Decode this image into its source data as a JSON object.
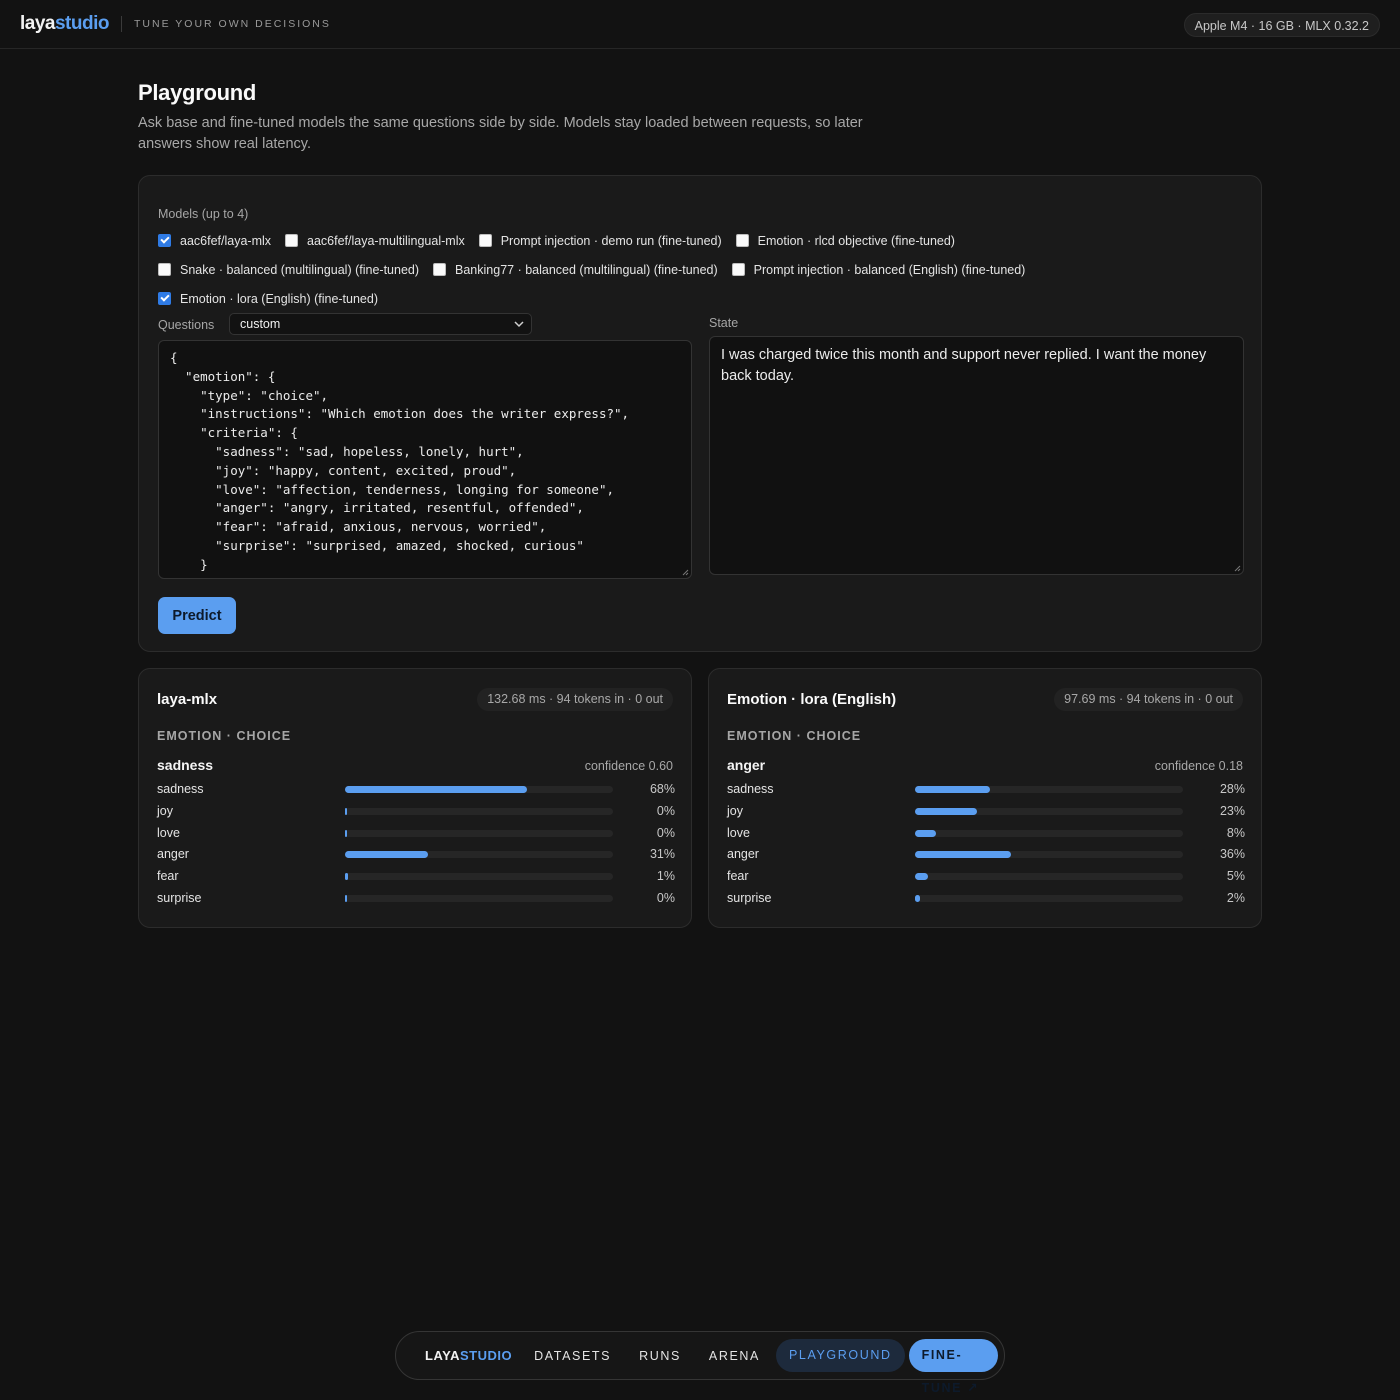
{
  "topbar": {
    "logo_part1": "laya",
    "logo_part2": "studio",
    "tagline": "TUNE YOUR OWN DECISIONS",
    "hardware": "Apple M4 · 16 GB · MLX 0.32.2"
  },
  "header": {
    "title": "Playground",
    "description": "Ask base and fine-tuned models the same questions side by side. Models stay loaded between requests, so later answers show real latency."
  },
  "models": {
    "label": "Models (up to 4)",
    "rows": [
      [
        {
          "label": "aac6fef/laya-mlx",
          "checked": true
        },
        {
          "label": "aac6fef/laya-multilingual-mlx",
          "checked": false
        },
        {
          "label": "Prompt injection · demo run (fine-tuned)",
          "checked": false
        },
        {
          "label": "Emotion · rlcd objective (fine-tuned)",
          "checked": false
        }
      ],
      [
        {
          "label": "Snake · balanced (multilingual) (fine-tuned)",
          "checked": false
        },
        {
          "label": "Banking77 · balanced (multilingual) (fine-tuned)",
          "checked": false
        },
        {
          "label": "Prompt injection · balanced (English) (fine-tuned)",
          "checked": false
        }
      ],
      [
        {
          "label": "Emotion · lora (English) (fine-tuned)",
          "checked": true
        }
      ]
    ]
  },
  "questions": {
    "label": "Questions",
    "selected": "custom",
    "code": "{\n  \"emotion\": {\n    \"type\": \"choice\",\n    \"instructions\": \"Which emotion does the writer express?\",\n    \"criteria\": {\n      \"sadness\": \"sad, hopeless, lonely, hurt\",\n      \"joy\": \"happy, content, excited, proud\",\n      \"love\": \"affection, tenderness, longing for someone\",\n      \"anger\": \"angry, irritated, resentful, offended\",\n      \"fear\": \"afraid, anxious, nervous, worried\",\n      \"surprise\": \"surprised, amazed, shocked, curious\"\n    }\n  }\n}"
  },
  "state": {
    "label": "State",
    "value": "I was charged twice this month and support never replied. I want the money back today."
  },
  "predict_label": "Predict",
  "results": [
    {
      "title": "laya-mlx",
      "meta": "132.68 ms · 94 tokens in · 0 out",
      "subtitle": "EMOTION · CHOICE",
      "prediction": "sadness",
      "confidence": "confidence 0.60",
      "rows": [
        {
          "name": "sadness",
          "pct": 68,
          "label": "68%"
        },
        {
          "name": "joy",
          "pct": 0,
          "label": "0%"
        },
        {
          "name": "love",
          "pct": 0,
          "label": "0%"
        },
        {
          "name": "anger",
          "pct": 31,
          "label": "31%"
        },
        {
          "name": "fear",
          "pct": 1,
          "label": "1%"
        },
        {
          "name": "surprise",
          "pct": 0,
          "label": "0%"
        }
      ]
    },
    {
      "title": "Emotion · lora (English)",
      "meta": "97.69 ms · 94 tokens in · 0 out",
      "subtitle": "EMOTION · CHOICE",
      "prediction": "anger",
      "confidence": "confidence 0.18",
      "rows": [
        {
          "name": "sadness",
          "pct": 28,
          "label": "28%"
        },
        {
          "name": "joy",
          "pct": 23,
          "label": "23%"
        },
        {
          "name": "love",
          "pct": 8,
          "label": "8%"
        },
        {
          "name": "anger",
          "pct": 36,
          "label": "36%"
        },
        {
          "name": "fear",
          "pct": 5,
          "label": "5%"
        },
        {
          "name": "surprise",
          "pct": 2,
          "label": "2%"
        }
      ]
    }
  ],
  "nav": {
    "logo_part1": "LAYA",
    "logo_part2": "STUDIO",
    "items": [
      "DATASETS",
      "RUNS",
      "ARENA"
    ],
    "active": "PLAYGROUND",
    "cta": "FINE-TUNE ↗"
  },
  "colors": {
    "accent": "#5b9ef0",
    "background": "#121212",
    "panel": "#1a1a1a"
  }
}
